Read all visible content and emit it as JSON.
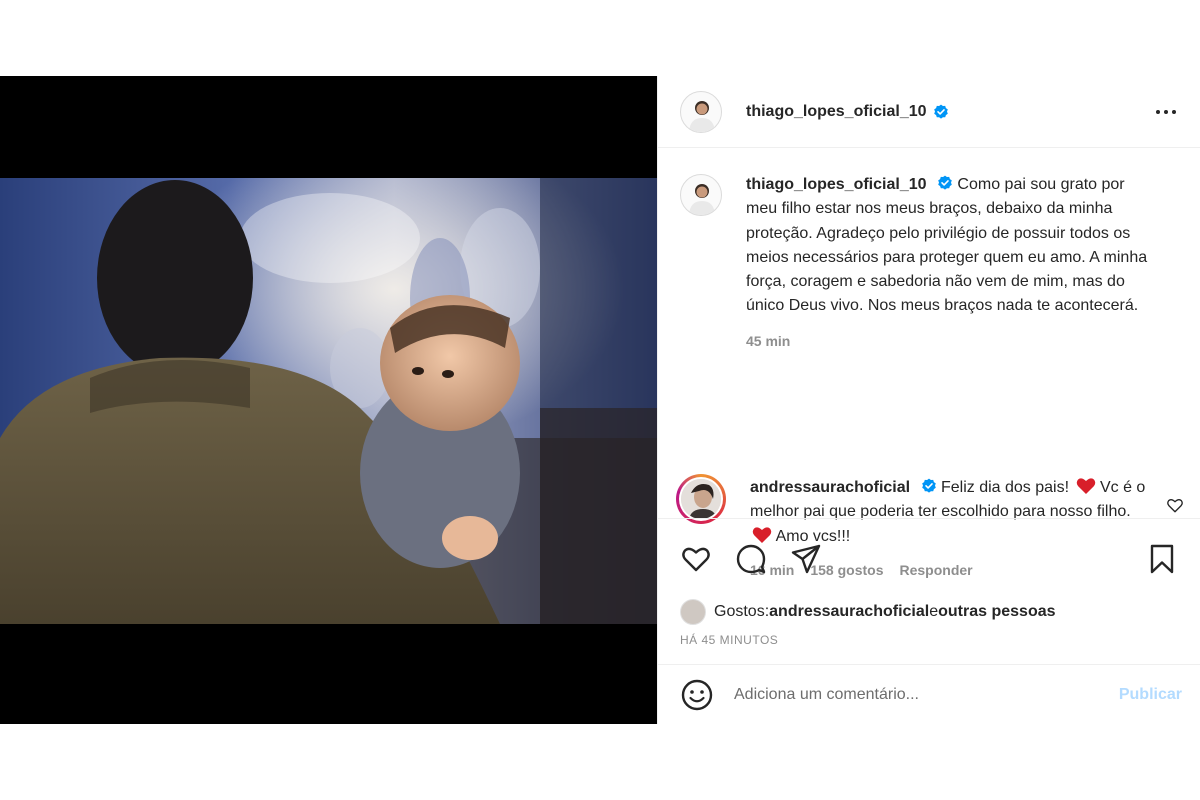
{
  "post": {
    "author": {
      "username": "thiago_lopes_oficial_10",
      "verified": true
    },
    "options_icon": "more-horizontal-icon",
    "caption": {
      "username": "thiago_lopes_oficial_10",
      "text": "Como pai sou grato por meu filho estar nos meus braços, debaixo da minha proteção. Agradeço pelo privilégio de possuir todos os meios necessários para proteger quem eu amo. A minha força, coragem e sabedoria não vem de mim, mas do único Deus vivo. Nos meus braços nada te acontecerá.",
      "time": "45 min"
    },
    "comments": [
      {
        "username": "andressaurachoficial",
        "verified": true,
        "text_part1": "Feliz dia dos pais!",
        "text_part2": "Vc é o melhor pai que poderia ter escolhido para nosso filho.",
        "text_part3": "Amo vcs!!!",
        "time": "16 min",
        "likes": "158 gostos",
        "reply_label": "Responder"
      }
    ],
    "actions": {
      "icons": [
        "heart-icon",
        "comment-icon",
        "share-icon",
        "bookmark-icon"
      ]
    },
    "likes_text": {
      "prefix": "Gostos: ",
      "user": "andressaurachoficial",
      "and": " e ",
      "others": "outras pessoas"
    },
    "timestamp": "HÁ 45 MINUTOS",
    "add_comment": {
      "placeholder": "Adiciona um comentário...",
      "publish_label": "Publicar"
    }
  },
  "colors": {
    "verified": "#0095f6",
    "heart": "#ed4956",
    "publish_disabled": "#b3dbff"
  }
}
